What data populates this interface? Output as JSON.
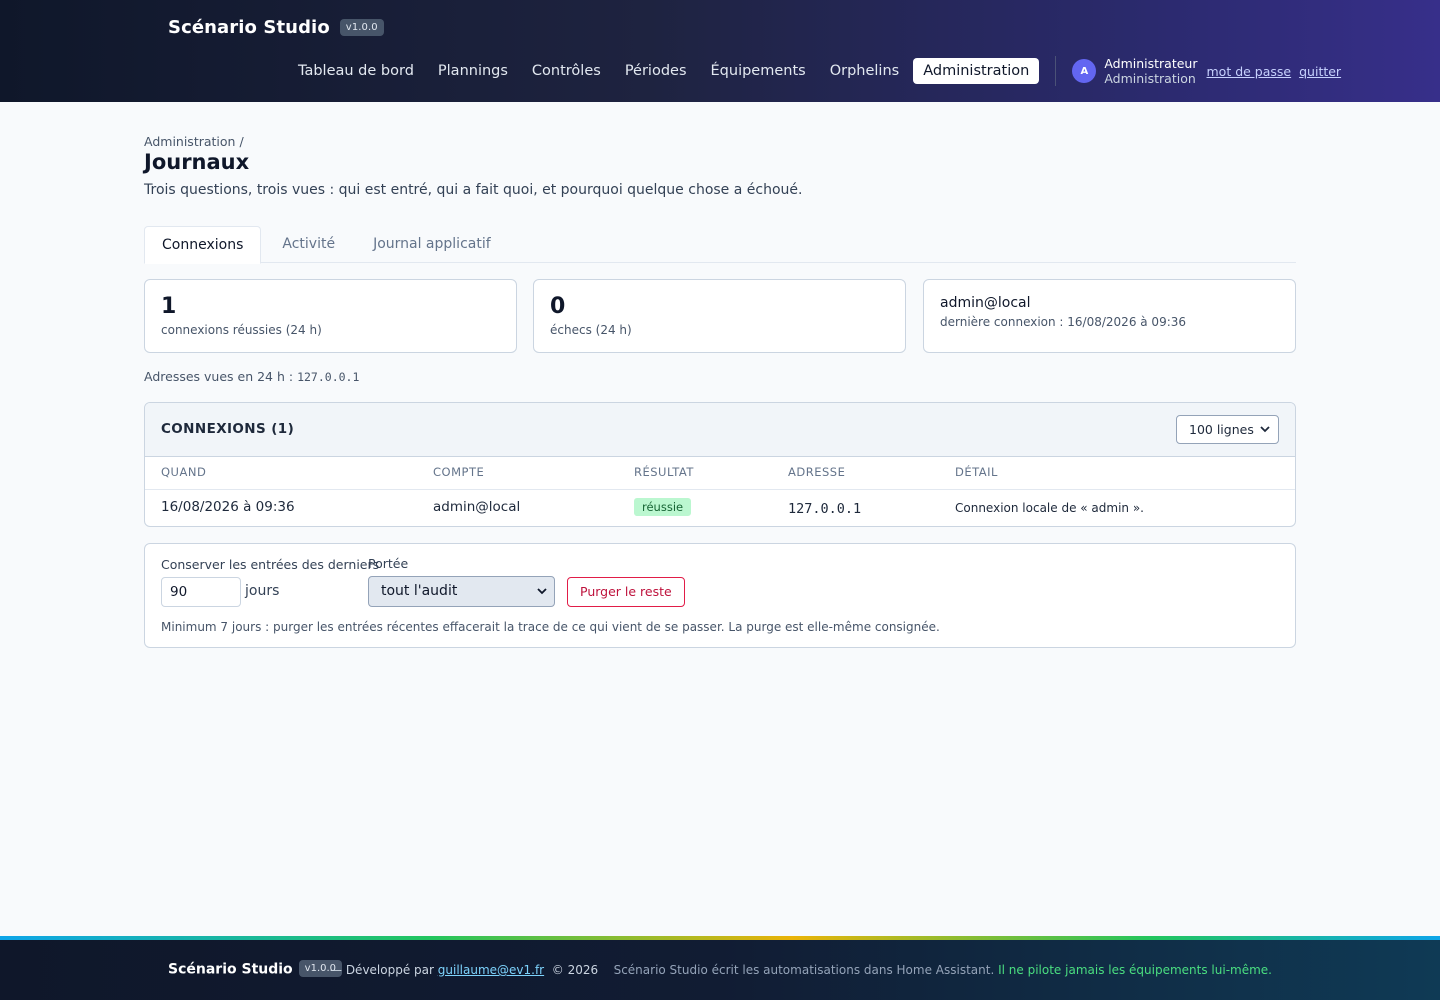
{
  "app": {
    "name": "Scénario Studio",
    "version": "v1.0.0"
  },
  "nav": {
    "items": [
      {
        "label": "Tableau de bord"
      },
      {
        "label": "Plannings"
      },
      {
        "label": "Contrôles"
      },
      {
        "label": "Périodes"
      },
      {
        "label": "Équipements"
      },
      {
        "label": "Orphelins"
      },
      {
        "label": "Administration",
        "active": true
      }
    ],
    "user": {
      "initial": "A",
      "name": "Administrateur",
      "role": "Administration",
      "password_link": "mot de passe",
      "quit_link": "quitter"
    }
  },
  "page": {
    "breadcrumb": "Administration /",
    "title": "Journaux",
    "subtitle": "Trois questions, trois vues : qui est entré, qui a fait quoi, et pourquoi quelque chose a échoué.",
    "tabs": [
      {
        "label": "Connexions",
        "active": true
      },
      {
        "label": "Activité"
      },
      {
        "label": "Journal applicatif"
      }
    ]
  },
  "stats": {
    "success": {
      "value": "1",
      "label": "connexions réussies (24 h)"
    },
    "failures": {
      "value": "0",
      "label": "échecs (24 h)"
    },
    "last_account": {
      "account": "admin@local",
      "last_login": "dernière connexion : 16/08/2026 à 09:36"
    }
  },
  "addresses": {
    "label": "Adresses vues en 24 h :",
    "value": "127.0.0.1"
  },
  "connections": {
    "title": "CONNEXIONS (1)",
    "page_size": "100 lignes",
    "columns": [
      "QUAND",
      "COMPTE",
      "RÉSULTAT",
      "ADRESSE",
      "DÉTAIL"
    ],
    "rows": [
      {
        "when": "16/08/2026 à 09:36",
        "account": "admin@local",
        "result": "réussie",
        "address": "127.0.0.1",
        "detail": "Connexion locale de « admin »."
      }
    ]
  },
  "purge": {
    "keep_label": "Conserver les entrées des derniers",
    "days_value": "90",
    "days_unit": "jours",
    "scope_label": "Portée",
    "scope_value": "tout l'audit",
    "button": "Purger le reste",
    "note": "Minimum 7 jours : purger les entrées récentes effacerait la trace de ce qui vient de se passer. La purge est elle-même consignée."
  },
  "footer": {
    "brand": "Scénario Studio",
    "version": "v1.0.0",
    "dev_prefix": "— Développé par",
    "email": "guillaume@ev1.fr",
    "copyright": "© 2026",
    "tagline": "Scénario Studio écrit les automatisations dans Home Assistant.",
    "tagline_accent": "Il ne pilote jamais les équipements lui-même."
  },
  "colors": {
    "accent": "#6366f1",
    "success_bg": "#bbf7d0",
    "success_text": "#166534",
    "danger": "#e11d48",
    "footer_accent": "#4ade80"
  }
}
